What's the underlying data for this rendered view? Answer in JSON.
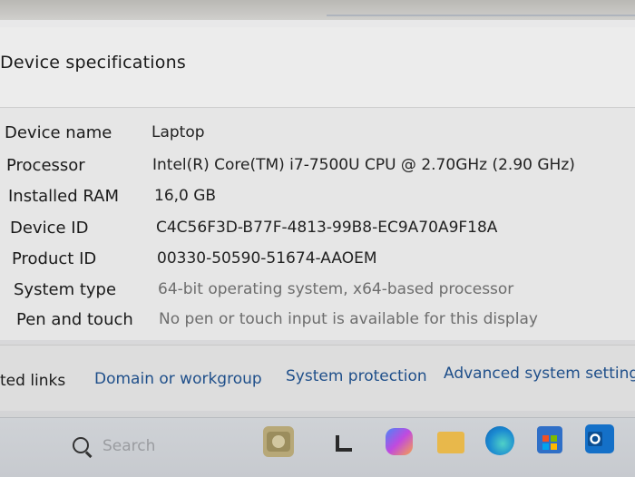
{
  "section_title": "Device specifications",
  "specs": [
    {
      "label": "Device name",
      "value": "Laptop"
    },
    {
      "label": "Processor",
      "value": "Intel(R) Core(TM) i7-7500U CPU @ 2.70GHz (2.90 GHz)"
    },
    {
      "label": "Installed RAM",
      "value": "16,0 GB"
    },
    {
      "label": "Device ID",
      "value": "C4C56F3D-B77F-4813-99B8-EC9A70A9F18A"
    },
    {
      "label": "Product ID",
      "value": "00330-50590-51674-AAOEM"
    },
    {
      "label": "System type",
      "value": "64-bit operating system, x64-based processor"
    },
    {
      "label": "Pen and touch",
      "value": "No pen or touch input is available for this display"
    }
  ],
  "related_links": {
    "title": "ted links",
    "items": [
      "Domain or workgroup",
      "System protection",
      "Advanced system settings"
    ]
  },
  "taskbar": {
    "search_placeholder": "Search",
    "apps": [
      "widgets-icon",
      "task-view-icon",
      "copilot-icon",
      "file-explorer-icon",
      "edge-icon",
      "store-icon",
      "outlook-icon"
    ]
  },
  "colors": {
    "link": "#1f4f8a",
    "windows_blue": "#2d7fd3"
  }
}
